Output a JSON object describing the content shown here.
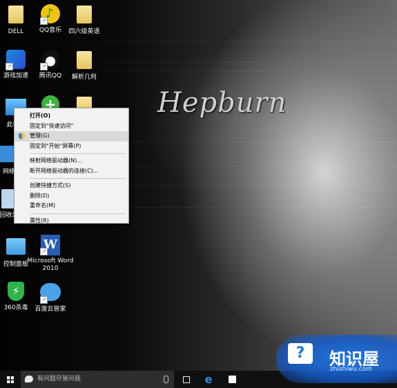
{
  "desktop": {
    "wallpaper_text": "Hepburn",
    "icons": [
      {
        "label": "DELL"
      },
      {
        "label": "QQ音乐"
      },
      {
        "label": "四六级英语"
      },
      {
        "label": "游戏加速"
      },
      {
        "label": "腾讯QQ"
      },
      {
        "label": "解析几何"
      },
      {
        "label": "此电脑"
      },
      {
        "label": "网络"
      },
      {
        "label": "回收站"
      },
      {
        "label": "控制面板"
      },
      {
        "label": "Microsoft Word 2010"
      },
      {
        "label": "360杀毒"
      },
      {
        "label": "百度云管家"
      }
    ]
  },
  "context_menu": {
    "items": [
      {
        "label": "打开(O)"
      },
      {
        "label": "固定到\"快速访问\""
      },
      {
        "label": "管理(G)"
      },
      {
        "label": "固定到\"开始\"屏幕(P)"
      },
      {
        "label": "映射网络驱动器(N)..."
      },
      {
        "label": "断开网络驱动器的连接(C)..."
      },
      {
        "label": "创建快捷方式(S)"
      },
      {
        "label": "删除(D)"
      },
      {
        "label": "重命名(M)"
      },
      {
        "label": "属性(R)"
      }
    ]
  },
  "taskbar": {
    "search_placeholder": "有问题尽管问我"
  },
  "watermark": {
    "title": "知识屋",
    "url": "zhishiwu.com"
  }
}
